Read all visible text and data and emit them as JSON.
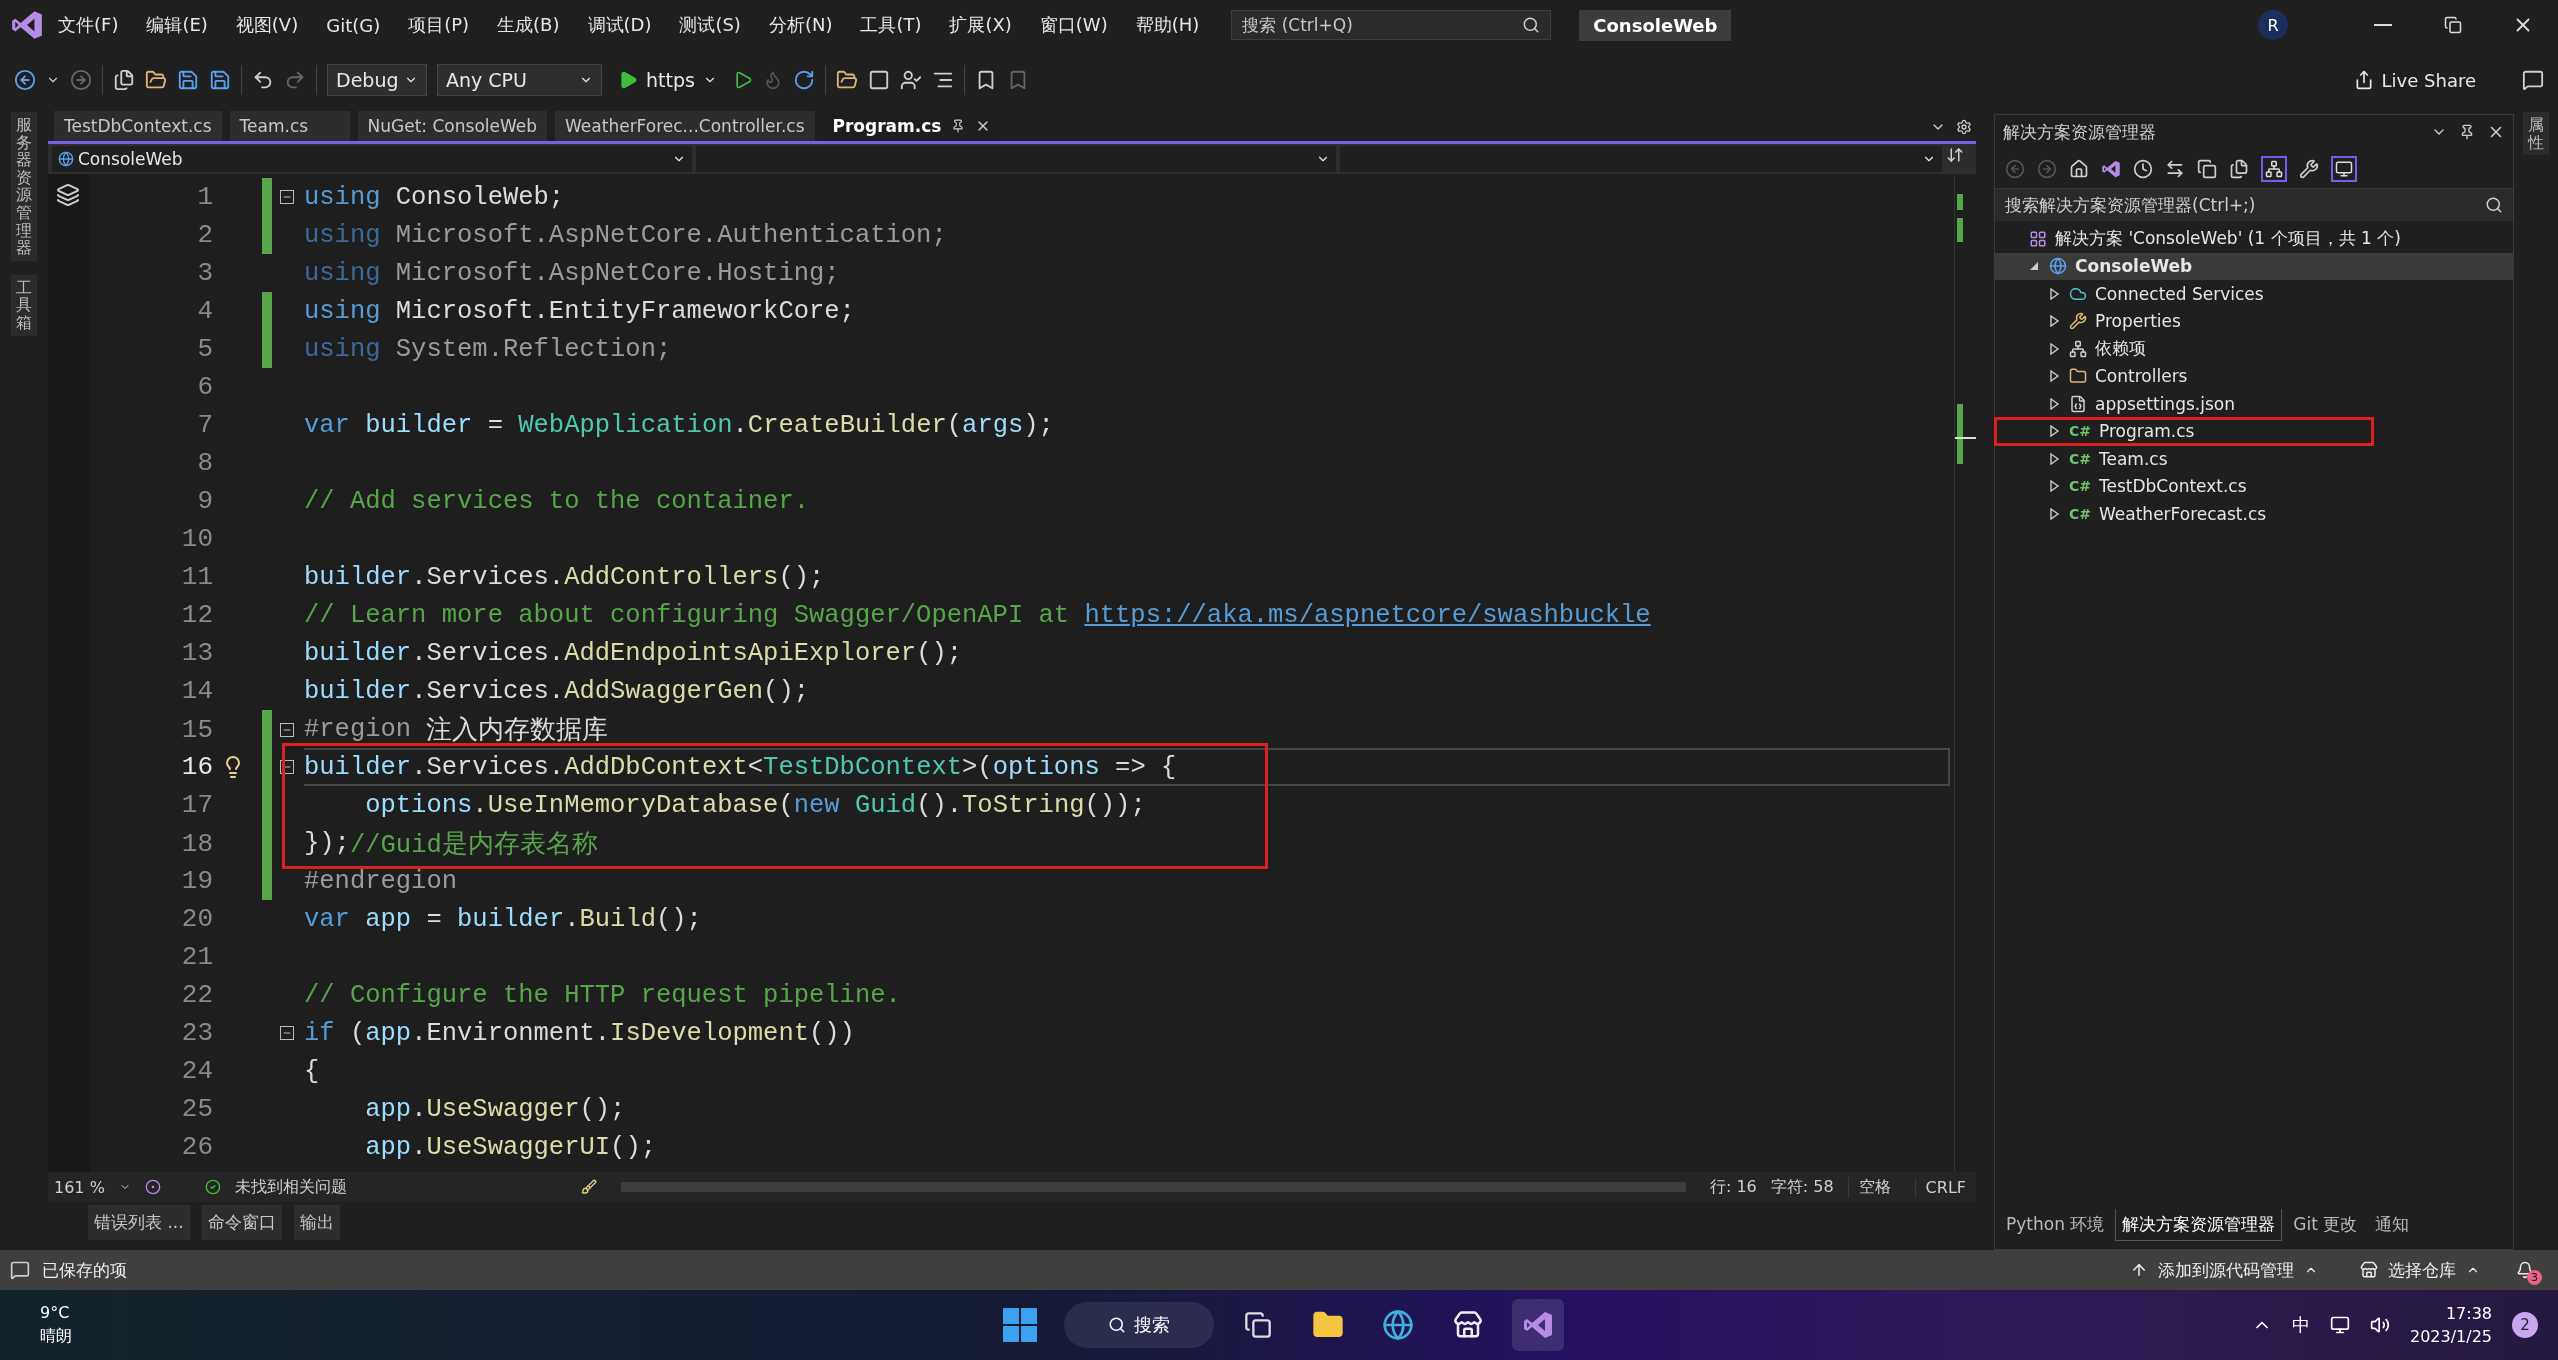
{
  "menu": [
    "文件(F)",
    "编辑(E)",
    "视图(V)",
    "Git(G)",
    "项目(P)",
    "生成(B)",
    "调试(D)",
    "测试(S)",
    "分析(N)",
    "工具(T)",
    "扩展(X)",
    "窗口(W)",
    "帮助(H)"
  ],
  "search": {
    "placeholder": "搜索 (Ctrl+Q)"
  },
  "solution_badge": "ConsoleWeb",
  "avatar": "R",
  "toolbar": {
    "configuration": "Debug",
    "platform": "Any CPU",
    "run_target": "https",
    "live_share": "Live Share"
  },
  "left_strip": [
    "服务器资源管理器",
    "工具箱"
  ],
  "right_strip": [
    "属性"
  ],
  "tabs": [
    {
      "label": "TestDbContext.cs",
      "selected": false
    },
    {
      "label": "Team.cs",
      "selected": false
    },
    {
      "label": "NuGet: ConsoleWeb",
      "selected": false
    },
    {
      "label": "WeatherForec...Controller.cs",
      "selected": false
    },
    {
      "label": "Program.cs",
      "selected": true
    }
  ],
  "nav_bar": {
    "project": "ConsoleWeb"
  },
  "code_lines": [
    {
      "number": "1",
      "changed": true,
      "fold_start": true,
      "current": false,
      "boxed": false,
      "tokens": [
        {
          "kind": "keyword",
          "text": "using"
        },
        {
          "kind": "plain",
          "text": " ConsoleWeb;"
        }
      ]
    },
    {
      "number": "2",
      "changed": true,
      "fold_start": false,
      "current": false,
      "boxed": false,
      "tokens": [
        {
          "kind": "dim_keyword",
          "text": "using"
        },
        {
          "kind": "dim",
          "text": " Microsoft.AspNetCore.Authentication;"
        }
      ]
    },
    {
      "number": "3",
      "changed": false,
      "fold_start": false,
      "current": false,
      "boxed": false,
      "tokens": [
        {
          "kind": "dim_keyword",
          "text": "using"
        },
        {
          "kind": "dim",
          "text": " Microsoft.AspNetCore.Hosting;"
        }
      ]
    },
    {
      "number": "4",
      "changed": true,
      "fold_start": false,
      "current": false,
      "boxed": false,
      "tokens": [
        {
          "kind": "keyword",
          "text": "using"
        },
        {
          "kind": "plain",
          "text": " Microsoft.EntityFrameworkCore;"
        }
      ]
    },
    {
      "number": "5",
      "changed": true,
      "fold_start": false,
      "current": false,
      "boxed": false,
      "tokens": [
        {
          "kind": "dim_keyword",
          "text": "using"
        },
        {
          "kind": "dim",
          "text": " System.Reflection;"
        }
      ]
    },
    {
      "number": "6",
      "changed": false,
      "fold_start": false,
      "current": false,
      "boxed": false
    },
    {
      "number": "7",
      "changed": false,
      "fold_start": false,
      "current": false,
      "boxed": false,
      "tokens": [
        {
          "kind": "keyword",
          "text": "var"
        },
        {
          "kind": "variable",
          "text": " builder"
        },
        {
          "kind": "plain",
          "text": " = "
        },
        {
          "kind": "type",
          "text": "WebApplication"
        },
        {
          "kind": "plain",
          "text": "."
        },
        {
          "kind": "method",
          "text": "CreateBuilder"
        },
        {
          "kind": "plain",
          "text": "("
        },
        {
          "kind": "variable",
          "text": "args"
        },
        {
          "kind": "plain",
          "text": ");"
        }
      ]
    },
    {
      "number": "8",
      "changed": false,
      "fold_start": false,
      "current": false,
      "boxed": false
    },
    {
      "number": "9",
      "changed": false,
      "fold_start": false,
      "current": false,
      "boxed": false,
      "tokens": [
        {
          "kind": "comment",
          "text": "// Add services to the container."
        }
      ]
    },
    {
      "number": "10",
      "changed": false,
      "fold_start": false,
      "current": false,
      "boxed": false
    },
    {
      "number": "11",
      "changed": false,
      "fold_start": false,
      "current": false,
      "boxed": false,
      "tokens": [
        {
          "kind": "variable",
          "text": "builder"
        },
        {
          "kind": "plain",
          "text": ".Services."
        },
        {
          "kind": "method",
          "text": "AddControllers"
        },
        {
          "kind": "plain",
          "text": "();"
        }
      ]
    },
    {
      "number": "12",
      "changed": false,
      "fold_start": false,
      "current": false,
      "boxed": false,
      "tokens": [
        {
          "kind": "comment",
          "text": "// Learn more about configuring Swagger/OpenAPI at "
        },
        {
          "kind": "link",
          "text": "https://aka.ms/aspnetcore/swashbuckle"
        }
      ]
    },
    {
      "number": "13",
      "changed": false,
      "fold_start": false,
      "current": false,
      "boxed": false,
      "tokens": [
        {
          "kind": "variable",
          "text": "builder"
        },
        {
          "kind": "plain",
          "text": ".Services."
        },
        {
          "kind": "method",
          "text": "AddEndpointsApiExplorer"
        },
        {
          "kind": "plain",
          "text": "();"
        }
      ]
    },
    {
      "number": "14",
      "changed": false,
      "fold_start": false,
      "current": false,
      "boxed": false,
      "tokens": [
        {
          "kind": "variable",
          "text": "builder"
        },
        {
          "kind": "plain",
          "text": ".Services."
        },
        {
          "kind": "method",
          "text": "AddSwaggerGen"
        },
        {
          "kind": "plain",
          "text": "();"
        }
      ]
    },
    {
      "number": "15",
      "changed": true,
      "fold_start": true,
      "current": false,
      "boxed": false,
      "tokens": [
        {
          "kind": "preprocessor",
          "text": "#region"
        },
        {
          "kind": "plain",
          "text": " 注入内存数据库"
        }
      ]
    },
    {
      "number": "16",
      "changed": true,
      "fold_start": true,
      "current": true,
      "boxed": true,
      "tokens": [
        {
          "kind": "variable",
          "text": "builder"
        },
        {
          "kind": "plain",
          "text": ".Services."
        },
        {
          "kind": "method",
          "text": "AddDbContext"
        },
        {
          "kind": "plain",
          "text": "<"
        },
        {
          "kind": "type",
          "text": "TestDbContext"
        },
        {
          "kind": "plain",
          "text": ">("
        },
        {
          "kind": "variable",
          "text": "options"
        },
        {
          "kind": "plain",
          "text": " => {"
        }
      ]
    },
    {
      "number": "17",
      "changed": true,
      "fold_start": false,
      "current": false,
      "boxed": true,
      "tokens": [
        {
          "kind": "variable",
          "text": "    options"
        },
        {
          "kind": "plain",
          "text": "."
        },
        {
          "kind": "method",
          "text": "UseInMemoryDatabase"
        },
        {
          "kind": "plain",
          "text": "("
        },
        {
          "kind": "keyword",
          "text": "new"
        },
        {
          "kind": "type",
          "text": " Guid"
        },
        {
          "kind": "plain",
          "text": "()."
        },
        {
          "kind": "method",
          "text": "ToString"
        },
        {
          "kind": "plain",
          "text": "());"
        }
      ]
    },
    {
      "number": "18",
      "changed": true,
      "fold_start": false,
      "current": false,
      "boxed": true,
      "tokens": [
        {
          "kind": "plain",
          "text": "});"
        },
        {
          "kind": "comment",
          "text": "//Guid是内存表名称"
        }
      ]
    },
    {
      "number": "19",
      "changed": true,
      "fold_start": false,
      "current": false,
      "boxed": false,
      "tokens": [
        {
          "kind": "preprocessor",
          "text": "#endregion"
        }
      ]
    },
    {
      "number": "20",
      "changed": false,
      "fold_start": false,
      "current": false,
      "boxed": false,
      "tokens": [
        {
          "kind": "keyword",
          "text": "var"
        },
        {
          "kind": "variable",
          "text": " app"
        },
        {
          "kind": "plain",
          "text": " = "
        },
        {
          "kind": "variable",
          "text": "builder"
        },
        {
          "kind": "plain",
          "text": "."
        },
        {
          "kind": "method",
          "text": "Build"
        },
        {
          "kind": "plain",
          "text": "();"
        }
      ]
    },
    {
      "number": "21",
      "changed": false,
      "fold_start": false,
      "current": false,
      "boxed": false
    },
    {
      "number": "22",
      "changed": false,
      "fold_start": false,
      "current": false,
      "boxed": false,
      "tokens": [
        {
          "kind": "comment",
          "text": "// Configure the HTTP request pipeline."
        }
      ]
    },
    {
      "number": "23",
      "changed": false,
      "fold_start": true,
      "current": false,
      "boxed": false,
      "tokens": [
        {
          "kind": "keyword",
          "text": "if"
        },
        {
          "kind": "plain",
          "text": " ("
        },
        {
          "kind": "variable",
          "text": "app"
        },
        {
          "kind": "plain",
          "text": ".Environment."
        },
        {
          "kind": "method",
          "text": "IsDevelopment"
        },
        {
          "kind": "plain",
          "text": "())"
        }
      ]
    },
    {
      "number": "24",
      "changed": false,
      "fold_start": false,
      "current": false,
      "boxed": false,
      "tokens": [
        {
          "kind": "plain",
          "text": "{"
        }
      ]
    },
    {
      "number": "25",
      "changed": false,
      "fold_start": false,
      "current": false,
      "boxed": false,
      "tokens": [
        {
          "kind": "variable",
          "text": "    app"
        },
        {
          "kind": "plain",
          "text": "."
        },
        {
          "kind": "method",
          "text": "UseSwagger"
        },
        {
          "kind": "plain",
          "text": "();"
        }
      ]
    },
    {
      "number": "26",
      "changed": false,
      "fold_start": false,
      "current": false,
      "boxed": false,
      "tokens": [
        {
          "kind": "variable",
          "text": "    app"
        },
        {
          "kind": "plain",
          "text": "."
        },
        {
          "kind": "method",
          "text": "UseSwaggerUI"
        },
        {
          "kind": "plain",
          "text": "();"
        }
      ]
    }
  ],
  "editor_status": {
    "zoom": "161 %",
    "issues": "未找到相关问题",
    "line": "行: 16",
    "column": "字符: 58",
    "indent": "空格",
    "line_ending": "CRLF"
  },
  "tool_tabs": [
    "错误列表 ...",
    "命令窗口",
    "输出"
  ],
  "solution_explorer": {
    "title": "解决方案资源管理器",
    "search_placeholder": "搜索解决方案资源管理器(Ctrl+;)",
    "tree": [
      {
        "label": "解决方案 'ConsoleWeb' (1 个项目，共 1 个)",
        "kind": "solution",
        "selected": false,
        "boxed": false,
        "children": [
          {
            "label": "ConsoleWeb",
            "kind": "project",
            "expanded": true,
            "selected": true,
            "boxed": false,
            "children": [
              {
                "label": "Connected Services",
                "kind": "services",
                "expanded": false,
                "selected": false,
                "boxed": false
              },
              {
                "label": "Properties",
                "kind": "properties",
                "expanded": false,
                "selected": false,
                "boxed": false
              },
              {
                "label": "依赖项",
                "kind": "dependencies",
                "expanded": false,
                "selected": false,
                "boxed": false
              },
              {
                "label": "Controllers",
                "kind": "folder",
                "expanded": false,
                "selected": false,
                "boxed": false
              },
              {
                "label": "appsettings.json",
                "kind": "json",
                "expanded": false,
                "selected": false,
                "boxed": false
              },
              {
                "label": "Program.cs",
                "kind": "csharp",
                "icon_text": "C#",
                "expanded": false,
                "selected": false,
                "boxed": true
              },
              {
                "label": "Team.cs",
                "kind": "csharp",
                "icon_text": "C#",
                "expanded": false,
                "selected": false,
                "boxed": false
              },
              {
                "label": "TestDbContext.cs",
                "kind": "csharp",
                "icon_text": "C#",
                "expanded": false,
                "selected": false,
                "boxed": false
              },
              {
                "label": "WeatherForecast.cs",
                "kind": "csharp",
                "icon_text": "C#",
                "expanded": false,
                "selected": false,
                "boxed": false
              }
            ]
          }
        ]
      }
    ],
    "bottom_tabs": [
      {
        "label": "Python 环境",
        "selected": false
      },
      {
        "label": "解决方案资源管理器",
        "selected": true
      },
      {
        "label": "Git 更改",
        "selected": false
      },
      {
        "label": "通知",
        "selected": false
      }
    ]
  },
  "status_bar": {
    "message": "已保存的项",
    "source_control": "添加到源代码管理",
    "repository": "选择仓库",
    "notifications": "3"
  },
  "taskbar": {
    "temperature": "9°C",
    "weather": "晴朗",
    "search": "搜索",
    "input_method": "中",
    "time": "17:38",
    "date": "2023/1/25",
    "badge": "2"
  }
}
